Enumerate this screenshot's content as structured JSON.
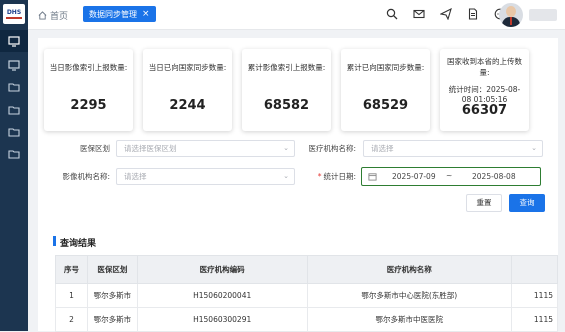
{
  "sidebar": {
    "logo_text": "DHS",
    "items": [
      "monitor-icon",
      "monitor-icon",
      "folder-icon",
      "folder-icon",
      "folder-icon",
      "folder-icon"
    ]
  },
  "header": {
    "home_label": "首页",
    "active_tab": "数据同步管理",
    "close_glyph": "×"
  },
  "cards": [
    {
      "label": "当日影像索引上报数量:",
      "value": "2295"
    },
    {
      "label": "当日已向国家同步数量:",
      "value": "2244"
    },
    {
      "label": "累计影像索引上报数量:",
      "value": "68582"
    },
    {
      "label": "累计已向国家同步数量:",
      "value": "68529"
    },
    {
      "label": "国家收到本省的上传数量:",
      "sub": "统计时间：2025-08-08 01:05:16",
      "value": "66307"
    }
  ],
  "filters": {
    "region_label": "医保区划",
    "region_placeholder": "请选择医保区划",
    "institution_label": "医疗机构名称:",
    "institution_placeholder": "请选择",
    "imaging_label": "影像机构名称:",
    "imaging_placeholder": "请选择",
    "date_label": "统计日期:",
    "date_start": "2025-07-09",
    "date_sep": "~",
    "date_end": "2025-08-08"
  },
  "buttons": {
    "reset": "重置",
    "query": "查询"
  },
  "results": {
    "title": "查询结果",
    "columns": [
      "序号",
      "医保区划",
      "医疗机构编码",
      "医疗机构名称",
      ""
    ],
    "rows": [
      [
        "1",
        "鄂尔多斯市",
        "H15060200041",
        "鄂尔多斯市中心医院(东胜部)",
        "1115"
      ],
      [
        "2",
        "鄂尔多斯市",
        "H15060300291",
        "鄂尔多斯市中医医院",
        "1115"
      ]
    ]
  },
  "colors": {
    "accent": "#1a73e8",
    "sidebar": "#1c3550",
    "date_border": "#2e7d32"
  }
}
